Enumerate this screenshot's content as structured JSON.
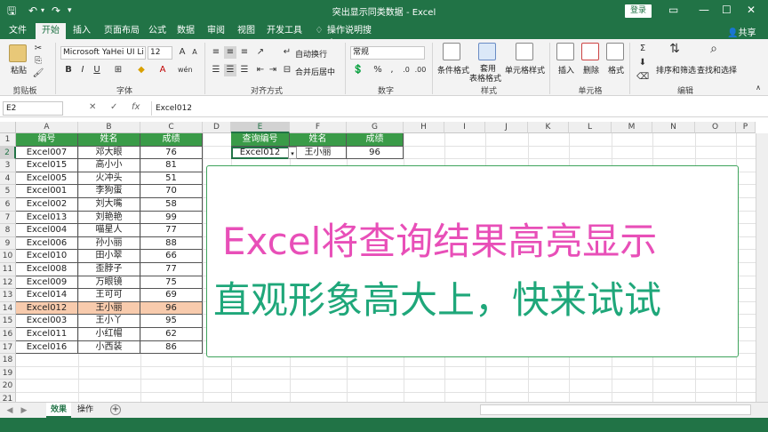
{
  "window": {
    "title": "突出显示同类数据  -  Excel",
    "login_label": "登录",
    "share_label": "共享",
    "tellme_label": "操作说明搜索"
  },
  "tabs": [
    "文件",
    "开始",
    "插入",
    "页面布局",
    "公式",
    "数据",
    "审阅",
    "视图",
    "开发工具"
  ],
  "ribbon": {
    "paste_label": "粘贴",
    "clipboard_label": "剪贴板",
    "font_name": "Microsoft YaHei UI Li",
    "font_size": "12",
    "font_group_label": "字体",
    "wrap_label": "自动换行",
    "merge_label": "合并后居中",
    "align_group_label": "对齐方式",
    "number_format": "常规",
    "number_group_label": "数字",
    "cond_format_label": "条件格式",
    "table_format_label1": "套用",
    "table_format_label2": "表格格式",
    "cell_style_label": "单元格样式",
    "style_group_label": "样式",
    "insert_label": "插入",
    "delete_label": "删除",
    "format_label": "格式",
    "cells_group_label": "单元格",
    "sort_filter_label": "排序和筛选",
    "find_select_label": "查找和选择",
    "edit_group_label": "编辑"
  },
  "formula_bar": {
    "name_box": "E2",
    "fx": "fx",
    "content": "Excel012"
  },
  "columns": [
    "A",
    "B",
    "C",
    "D",
    "E",
    "F",
    "G",
    "H",
    "I",
    "J",
    "K",
    "L",
    "M",
    "N",
    "O",
    "P"
  ],
  "rows": [
    "1",
    "2",
    "3",
    "4",
    "5",
    "6",
    "7",
    "8",
    "9",
    "10",
    "11",
    "12",
    "13",
    "14",
    "15",
    "16",
    "17",
    "18",
    "19",
    "20",
    "21"
  ],
  "table": {
    "headers": [
      "编号",
      "姓名",
      "成绩"
    ],
    "data": [
      [
        "Excel007",
        "邓大眼",
        "76"
      ],
      [
        "Excel015",
        "高小小",
        "81"
      ],
      [
        "Excel005",
        "火冲头",
        "51"
      ],
      [
        "Excel001",
        "李狗蛋",
        "70"
      ],
      [
        "Excel002",
        "刘大嘴",
        "58"
      ],
      [
        "Excel013",
        "刘艳艳",
        "99"
      ],
      [
        "Excel004",
        "喵星人",
        "77"
      ],
      [
        "Excel006",
        "孙小丽",
        "88"
      ],
      [
        "Excel010",
        "田小翠",
        "66"
      ],
      [
        "Excel008",
        "歪脖子",
        "77"
      ],
      [
        "Excel009",
        "万眼镜",
        "75"
      ],
      [
        "Excel014",
        "王可可",
        "69"
      ],
      [
        "Excel012",
        "王小丽",
        "96"
      ],
      [
        "Excel003",
        "王小丫",
        "95"
      ],
      [
        "Excel011",
        "小红帽",
        "62"
      ],
      [
        "Excel016",
        "小西装",
        "86"
      ]
    ],
    "highlight_row_index": 12
  },
  "query": {
    "headers": [
      "查询编号",
      "姓名",
      "成绩"
    ],
    "values": [
      "Excel012",
      "王小丽",
      "96"
    ]
  },
  "overlay": {
    "line1": "Excel将查询结果高亮显示",
    "line2": "直观形象高大上，快来试试"
  },
  "sheets": [
    "效果",
    "操作"
  ],
  "colors": {
    "excel_green": "#217346",
    "header_fill": "#3a9b48",
    "highlight_fill": "#f8cbad",
    "line1_color": "#e84fb8",
    "line2_color": "#1fa77a"
  }
}
